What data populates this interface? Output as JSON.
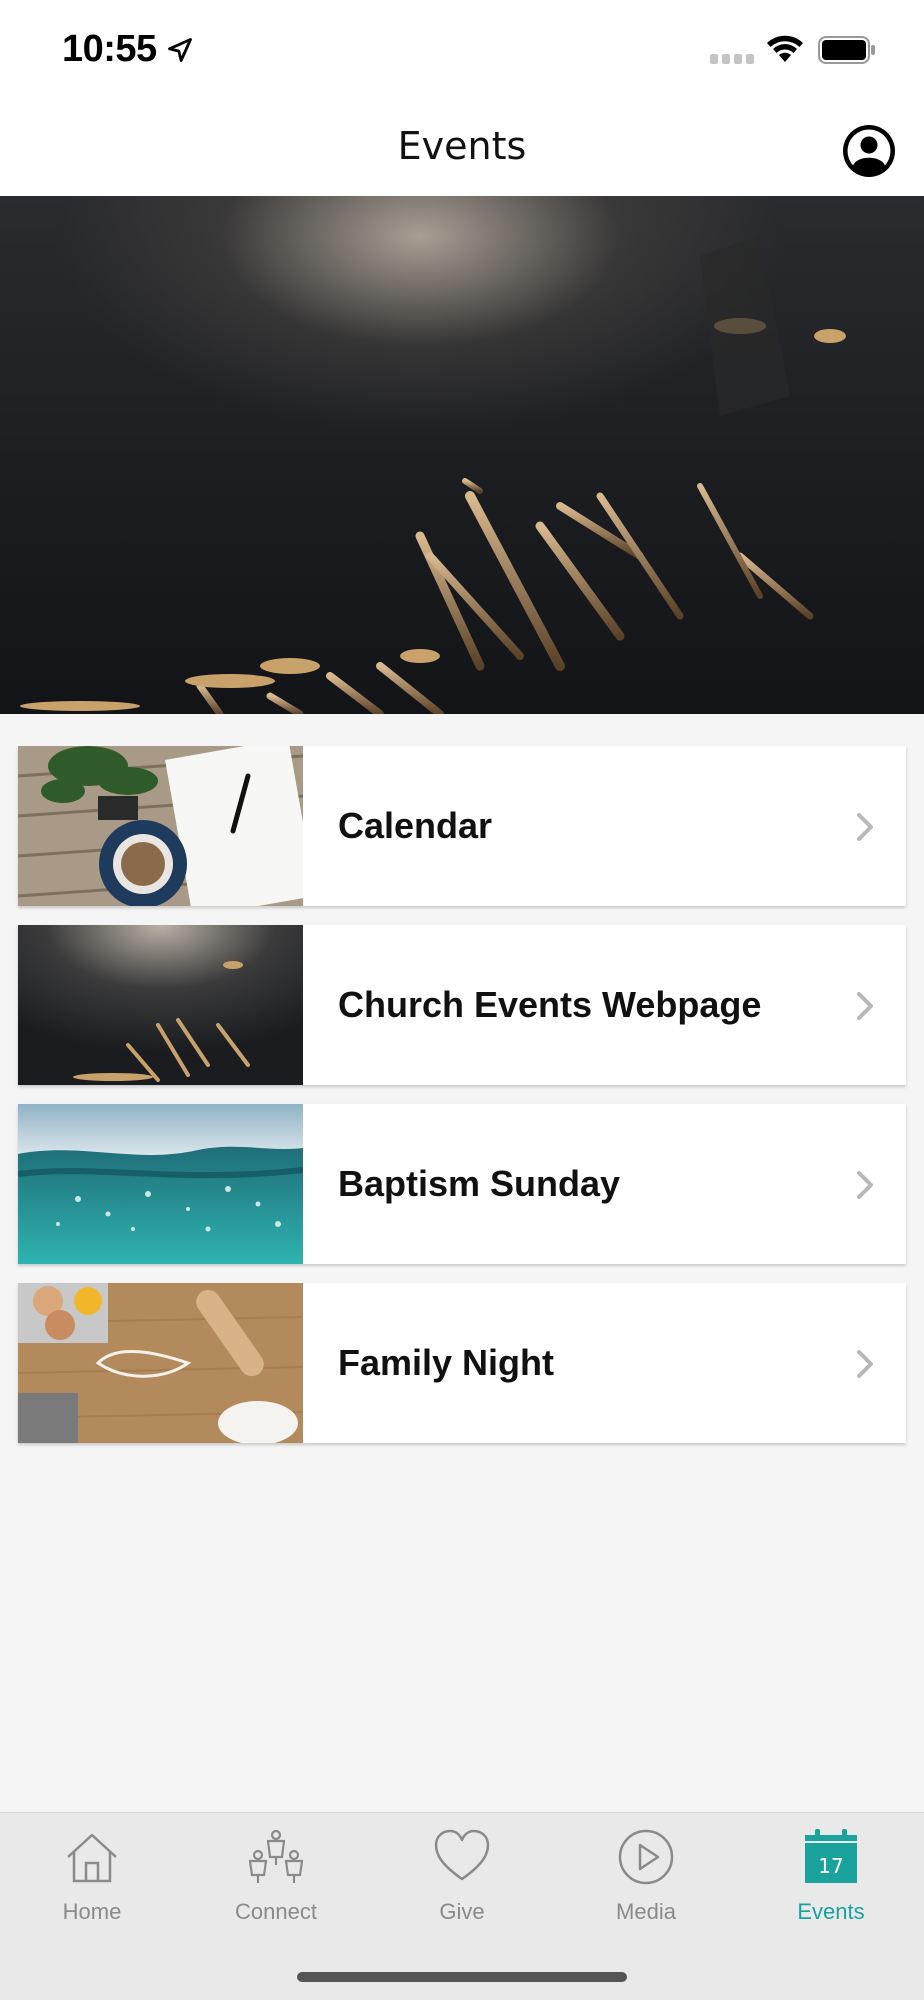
{
  "status_bar": {
    "time": "10:55",
    "icons": [
      "location-arrow-icon",
      "signal-icon",
      "wifi-icon",
      "battery-icon"
    ]
  },
  "nav": {
    "title": "Events",
    "profile_icon": "profile-icon"
  },
  "events": [
    {
      "label": "Calendar",
      "thumb": "calendar-thumbnail"
    },
    {
      "label": "Church Events Webpage",
      "thumb": "worship-thumbnail"
    },
    {
      "label": "Baptism Sunday",
      "thumb": "water-thumbnail"
    },
    {
      "label": "Family Night",
      "thumb": "family-baking-thumbnail"
    }
  ],
  "tabs": [
    {
      "label": "Home",
      "icon": "home-icon"
    },
    {
      "label": "Connect",
      "icon": "connect-icon"
    },
    {
      "label": "Give",
      "icon": "heart-icon"
    },
    {
      "label": "Media",
      "icon": "play-icon"
    },
    {
      "label": "Events",
      "icon": "calendar-icon",
      "badge": "17",
      "active": true
    }
  ],
  "colors": {
    "accent": "#1aa29d",
    "inactive_tab": "#8a8a8a",
    "background": "#f5f5f5"
  }
}
